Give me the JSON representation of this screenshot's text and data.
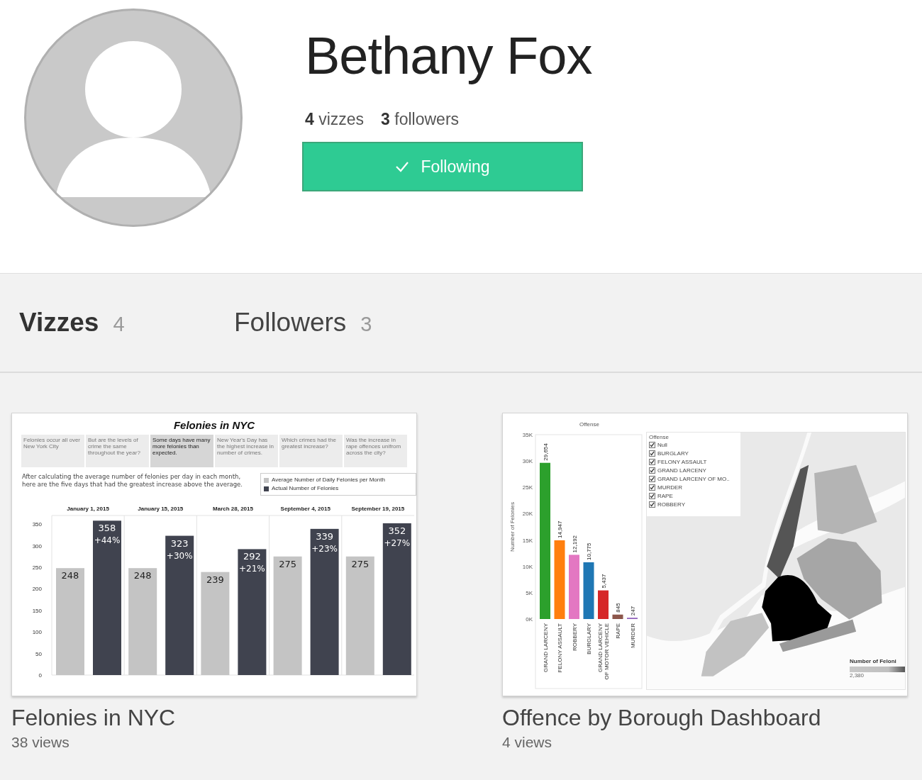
{
  "profile": {
    "name": "Bethany Fox",
    "vizzes_count": "4",
    "vizzes_label": "vizzes",
    "followers_count": "3",
    "followers_label": "followers",
    "follow_button": {
      "label": "Following",
      "following": true
    }
  },
  "tabs": [
    {
      "label": "Vizzes",
      "count": "4",
      "selected": true
    },
    {
      "label": "Followers",
      "count": "3",
      "selected": false
    }
  ],
  "vizzes": [
    {
      "title": "Felonies in NYC",
      "views": "38 views",
      "thumbnail": {
        "kind": "story",
        "heading": "Felonies in NYC",
        "story_points": [
          {
            "text": "Felonies occur all over New York City",
            "selected": false
          },
          {
            "text": "But are the levels of crime the same throughout the year?",
            "selected": false
          },
          {
            "text": "Some days have many more felonies than expected.",
            "selected": true
          },
          {
            "text": "New Year's Day has the highest increase in number of crimes.",
            "selected": false
          },
          {
            "text": "Which crimes had the greatest increase?",
            "selected": false
          },
          {
            "text": "Was the increase in rape offences unifrom across the city?",
            "selected": false
          }
        ],
        "caption": "After calculating the average number of felonies per day in each month, here are the five days that had the greatest increase above the average.",
        "chart_data": {
          "type": "bar",
          "categories": [
            "January 1, 2015",
            "January 15, 2015",
            "March 28, 2015",
            "September 4, 2015",
            "September 19, 2015"
          ],
          "series": [
            {
              "name": "Average Number of Daily Felonies per Month",
              "color": "#c4c4c4",
              "values": [
                248,
                248,
                239,
                275,
                275
              ]
            },
            {
              "name": "Actual Number of Felonies",
              "color": "#40434f",
              "values": [
                358,
                323,
                292,
                339,
                352
              ]
            }
          ],
          "yticks": [
            0,
            50,
            100,
            150,
            200,
            250,
            300,
            350
          ],
          "ylim": [
            0,
            370
          ],
          "data_labels": true,
          "annotations": [
            "+44%",
            "+30%",
            "+21%",
            "+23%",
            "+27%"
          ]
        }
      }
    },
    {
      "title": "Offence by Borough Dashboard",
      "views": "4 views",
      "thumbnail": {
        "kind": "dashboard",
        "chart_data": {
          "type": "bar",
          "title": "Offense",
          "ylabel": "Number of Felonies",
          "categories": [
            "GRAND LARCENY",
            "FELONY ASSAULT",
            "ROBBERY",
            "BURGLARY",
            "GRAND LARCENY OF MOTOR VEHICLE",
            "RAPE",
            "MURDER"
          ],
          "values": [
            29654,
            14947,
            12192,
            10775,
            5437,
            845,
            247
          ],
          "value_labels": [
            "29,654",
            "14,947",
            "12,192",
            "10,775",
            "5,437",
            "845",
            "247"
          ],
          "yticks": [
            {
              "value": 0,
              "label": "0K"
            },
            {
              "value": 5000,
              "label": "5K"
            },
            {
              "value": 10000,
              "label": "10K"
            },
            {
              "value": 15000,
              "label": "15K"
            },
            {
              "value": 20000,
              "label": "20K"
            },
            {
              "value": 25000,
              "label": "25K"
            },
            {
              "value": 30000,
              "label": "30K"
            },
            {
              "value": 35000,
              "label": "35K"
            }
          ],
          "ylim": [
            0,
            35000
          ]
        },
        "bar_fills": [
          {
            "color": "#2ca02c"
          },
          {
            "color": "#ff7f0e"
          },
          {
            "color": "#e377c2"
          },
          {
            "color": "#1f77b4"
          },
          {
            "color": "#d62728"
          },
          {
            "color": "#8c564b"
          },
          {
            "color": "#9467bd"
          }
        ],
        "filter": {
          "title": "Offense",
          "items": [
            {
              "label": "Null",
              "checked": true
            },
            {
              "label": "BURGLARY",
              "checked": true
            },
            {
              "label": "FELONY ASSAULT",
              "checked": true
            },
            {
              "label": "GRAND LARCENY",
              "checked": true
            },
            {
              "label": "GRAND LARCENY OF MO..",
              "checked": true
            },
            {
              "label": "MURDER",
              "checked": true
            },
            {
              "label": "RAPE",
              "checked": true
            },
            {
              "label": "ROBBERY",
              "checked": true
            }
          ]
        },
        "color_legend": {
          "title": "Number of Feloni",
          "min_label": "2,380"
        }
      }
    }
  ]
}
